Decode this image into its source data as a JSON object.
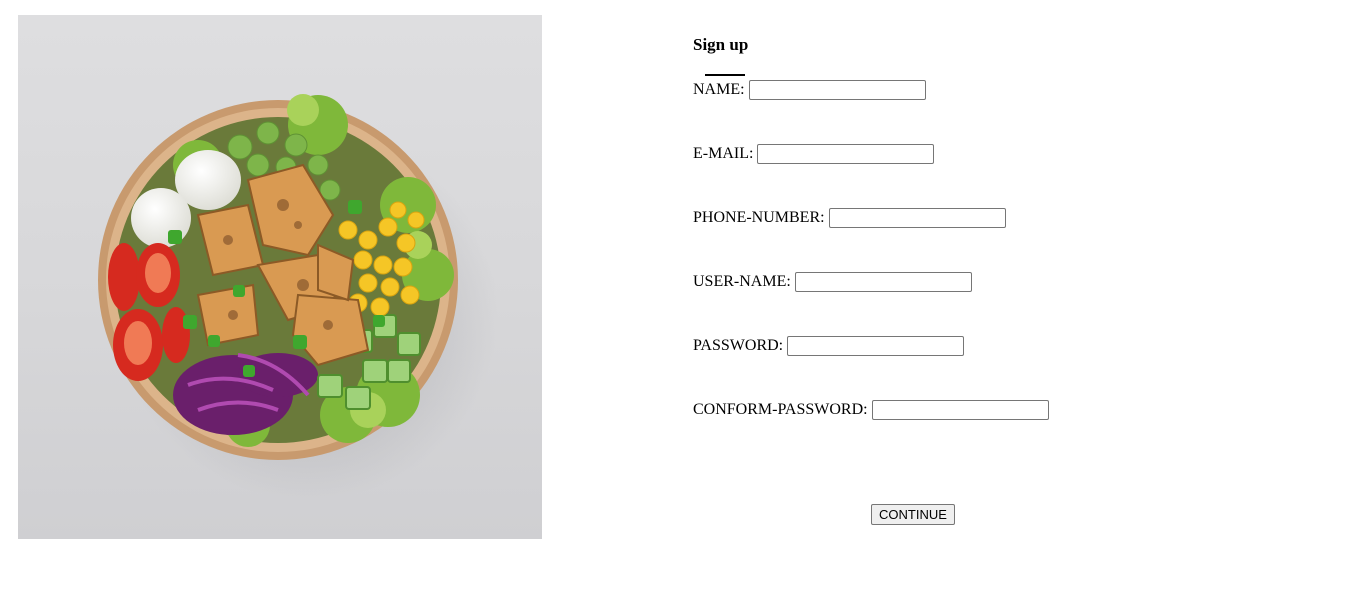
{
  "photo": {
    "alt": "Salad bowl with tofu, egg, corn, tomatoes, cucumber, red cabbage and lettuce"
  },
  "form": {
    "title": "Sign up",
    "fields": [
      {
        "label": "NAME:",
        "value": "",
        "placeholder": ""
      },
      {
        "label": "E-MAIL:",
        "value": "",
        "placeholder": ""
      },
      {
        "label": "PHONE-NUMBER:",
        "value": "",
        "placeholder": ""
      },
      {
        "label": "USER-NAME:",
        "value": "",
        "placeholder": ""
      },
      {
        "label": "PASSWORD:",
        "value": "",
        "placeholder": ""
      },
      {
        "label": "CONFORM-PASSWORD:",
        "value": "",
        "placeholder": ""
      }
    ],
    "continue_label": "CONTINUE"
  },
  "colors": {
    "background": "#ffffff",
    "photo_background": "#d9d9db",
    "input_border": "#767676",
    "button_background": "#efefef"
  }
}
